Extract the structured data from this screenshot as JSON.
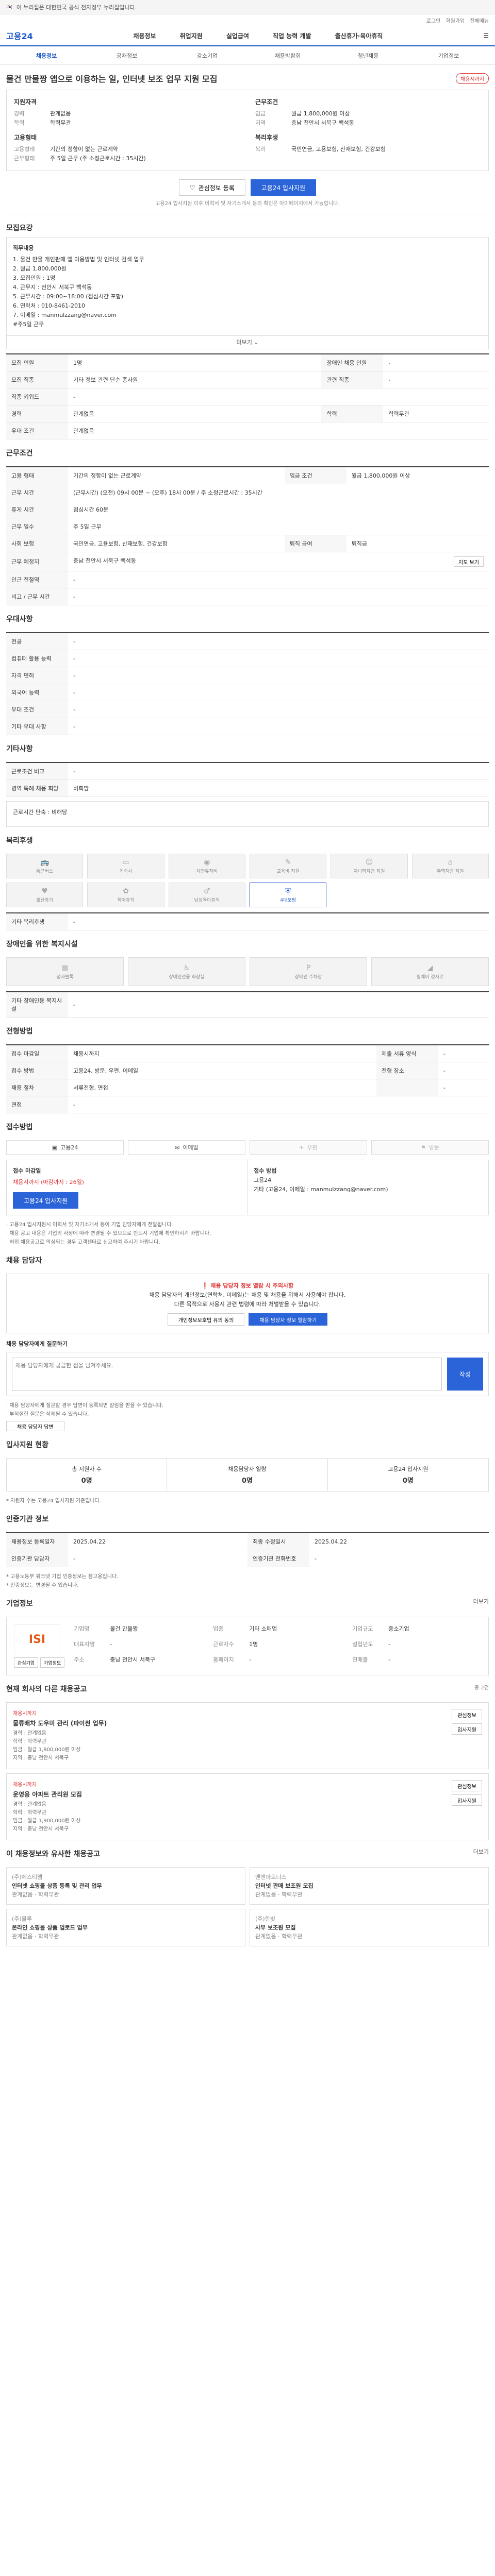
{
  "header": {
    "top_strip": "이 누리집은 대한민국 공식 전자정부 누리집입니다.",
    "logo": "고용24",
    "util": [
      "로그인",
      "회원가입",
      "전체메뉴"
    ],
    "gnb_logo": "고용24",
    "gnb_items": [
      "채용정보",
      "취업지원",
      "실업급여",
      "직업 능력 개발",
      "출산휴가·육아휴직"
    ],
    "tabs": [
      "채용정보",
      "공채정보",
      "강소기업",
      "채용박람회",
      "청년채용",
      "기업정보"
    ]
  },
  "job": {
    "title": "물건 만물짱 앱으로 이용하는 일, 인터넷 보조 업무 지원 모집",
    "badge": "채용시까지",
    "left_h": "지원자격",
    "left": [
      [
        "경력",
        "관계없음"
      ],
      [
        "학력",
        "학력무관"
      ]
    ],
    "left_h2": "고용형태",
    "left2": [
      [
        "고용형태",
        "기간의 정함이 없는 근로계약"
      ],
      [
        "근무형태",
        "주 5일 근무 (주 소정근로시간 : 35시간)"
      ]
    ],
    "right_h": "근무조건",
    "right": [
      [
        "임금",
        "월급 1,800,000원 이상"
      ],
      [
        "지역",
        "충남 천안시 서북구 백석동"
      ]
    ],
    "right_h2": "복리후생",
    "right2": [
      [
        "복리",
        "국민연금, 고용보험, 산재보험, 건강보험"
      ]
    ],
    "btn_scrap": "관심정보 등록",
    "btn_apply": "고용24 입사지원",
    "note": "고용24 입사지원 이후 이력서 및 자기소개서 등의 확인은 마이페이지에서 가능합니다."
  },
  "recruit": {
    "title": "모집요강",
    "box_h": "직무내용",
    "lines": [
      "1. 물건 만물 개인판매 앱 이용방법 및 인터넷 검색 업무",
      "2. 월급 1,800,000원",
      "3. 모집인원 : 1명",
      "4. 근무지 : 천안시 서북구 백석동",
      "5. 근무시간 : 09:00~18:00 (점심시간 포함)",
      "6. 연락처 : 010-8461-2010",
      "7. 이메일 : manmulzzang@naver.com",
      "#주5일 근무"
    ],
    "more": "더보기",
    "rows": [
      [
        "모집 인원",
        "1명",
        "장애인 채용 인원",
        "-"
      ],
      [
        "모집 직종",
        "기타 정보 관련 단순 종사원",
        "관련 직종",
        "-"
      ],
      [
        "직종 키워드",
        "-",
        "",
        ""
      ],
      [
        "경력",
        "관계없음",
        "학력",
        "학력무관"
      ],
      [
        "우대 조건",
        "관계없음",
        "",
        ""
      ]
    ]
  },
  "work": {
    "title": "근무조건",
    "rows": [
      [
        "고용 형태",
        "기간의 정함이 없는 근로계약",
        "임금 조건",
        "월급 1,800,000원 이상"
      ],
      [
        "근무 시간",
        "(근무시간) (오전) 09시 00분 ~ (오후) 18시 00분 / 주 소정근로시간 : 35시간",
        "",
        ""
      ],
      [
        "휴게 시간",
        "점심시간 60분",
        "",
        ""
      ],
      [
        "근무 일수",
        "주 5일 근무",
        "",
        ""
      ],
      [
        "사회 보험",
        "국민연금, 고용보험, 산재보험, 건강보험",
        "퇴직 급여",
        "퇴직금"
      ],
      [
        "근무 예정지",
        "충남 천안시 서북구 백석동",
        "",
        ""
      ],
      [
        "인근 전철역",
        "-",
        "",
        ""
      ],
      [
        "비고 / 근무 시간",
        "-",
        "",
        ""
      ]
    ],
    "map_btn": "지도 보기"
  },
  "prefer": {
    "title": "우대사항",
    "rows": [
      [
        "전공",
        "-"
      ],
      [
        "컴퓨터 활용 능력",
        "-"
      ],
      [
        "자격 면허",
        "-"
      ],
      [
        "외국어 능력",
        "-"
      ],
      [
        "우대 조건",
        "-"
      ],
      [
        "기타 우대 사항",
        "-"
      ]
    ]
  },
  "etc": {
    "title": "기타사항",
    "rows": [
      [
        "근로조건 비교",
        "-"
      ],
      [
        "병역 특례 채용 희망",
        "비희망"
      ]
    ],
    "box": "근로시간 단축 : 비해당"
  },
  "welfare": {
    "title": "복리후생",
    "items": [
      [
        "통근버스",
        "bus"
      ],
      [
        "기숙사",
        "bed"
      ],
      [
        "차량유지비",
        "car"
      ],
      [
        "교육비 지원",
        "edu"
      ],
      [
        "자녀학자금 지원",
        "child"
      ],
      [
        "주택자금 지원",
        "house"
      ],
      [
        "출산휴가",
        "baby"
      ],
      [
        "육아휴직",
        "care"
      ],
      [
        "남성육아휴직",
        "male"
      ],
      [
        "4대보험",
        "shield"
      ]
    ],
    "etc_label": "기타 복리후생",
    "etc_value": "-"
  },
  "disabled": {
    "title": "장애인을 위한 복지시설",
    "items": [
      "점자블록",
      "장애인전용 화장실",
      "장애인 주차장",
      "휠체어 경사로"
    ],
    "etc_label": "기타 장애인용 복지시설",
    "etc_value": "-"
  },
  "selection": {
    "title": "전형방법",
    "rows": [
      [
        "접수 마감일",
        "채용시까지",
        "제출 서류 양식",
        "-"
      ],
      [
        "접수 방법",
        "고용24, 방문, 우편, 이메일",
        "전형 장소",
        "-"
      ],
      [
        "채용 절차",
        "서류전형, 면접",
        "",
        "-"
      ],
      [
        "면접",
        "-",
        "",
        ""
      ]
    ]
  },
  "apply": {
    "title": "접수방법",
    "methods": [
      "고용24",
      "이메일",
      "우편",
      "방문"
    ],
    "left_h": "접수 마감일",
    "deadline": "채용시까지 (마감까지 : 26일)",
    "right_h": "접수 방법",
    "right_lines": [
      "고용24",
      "기타 (고용24, 이메일 : manmulzzang@naver.com)"
    ],
    "btn": "고용24 입사지원",
    "notices": [
      "· 고용24 입사지원시 이력서 및 자기소개서 등이 기업 담당자에게 전달됩니다.",
      "· 채용 공고 내용은 기업의 사정에 따라 변경될 수 있으므로 반드시 기업에 확인하시기 바랍니다.",
      "· 허위 채용공고로 의심되는 경우 고객센터로 신고하여 주시기 바랍니다."
    ]
  },
  "contact": {
    "title": "채용 담당자",
    "alert_title": "채용 담당자 정보 열람 시 주의사항",
    "alert_lines": [
      "채용 담당자의 개인정보(연락처, 이메일)는 채용 및 채용을 위해서 사용해야 합니다.",
      "다른 목적으로 사용시 관련 법령에 따라 처벌받을 수 있습니다."
    ],
    "btn_confirm": "개인정보보호법 유의 동의",
    "btn_show": "채용 담당자 정보 열람하기",
    "qa_h": "채용 담당자에게 질문하기",
    "qa_placeholder": "채용 담당자에게 궁금한 점을 남겨주세요.",
    "qa_btn": "작성",
    "qa_notes": [
      "· 채용 담당자에게 질문할 경우 답변이 등록되면 알림을 받을 수 있습니다.",
      "· 부적절한 질문은 삭제될 수 있습니다."
    ],
    "qa_extra": "채용 담당자 답변"
  },
  "stats": {
    "title": "입사지원 현황",
    "items": [
      [
        "총 지원자 수",
        "0명"
      ],
      [
        "채용담당자 열람",
        "0명"
      ],
      [
        "고용24 입사지원",
        "0명"
      ]
    ],
    "note": "* 지원자 수는 고용24 입사지원 기준입니다."
  },
  "info": {
    "title": "인증기관 정보",
    "rows": [
      [
        "채용정보 등록일자",
        "2025.04.22",
        "최종 수정일시",
        "2025.04.22"
      ],
      [
        "인증기관 담당자",
        "-",
        "인증기관 전화번호",
        "-"
      ]
    ],
    "notes": [
      "* 고용노동부 워크넷 기업 인증정보는 참고용입니다.",
      "* 인증정보는 변경될 수 있습니다."
    ]
  },
  "company": {
    "title": "기업정보",
    "more": "더보기",
    "logo_text": "ISI",
    "rows": [
      [
        "기업명",
        "물건 만물짱"
      ],
      [
        "업종",
        "기타 소매업"
      ],
      [
        "기업규모",
        "중소기업"
      ],
      [
        "대표자명",
        "-"
      ],
      [
        "근로자수",
        "1명"
      ],
      [
        "설립년도",
        "-"
      ],
      [
        "주소",
        "충남 천안시 서북구"
      ],
      [
        "홈페이지",
        "-"
      ],
      [
        "연매출",
        "-"
      ]
    ],
    "btn1": "관심기업",
    "btn2": "기업정보"
  },
  "others": {
    "title": "현재 회사의 다른 채용공고",
    "note": "총 2건",
    "jobs": [
      {
        "tag": "채용시까지",
        "title": "물류배차 도우미 관리 (파이썬 업무)",
        "meta": [
          "경력 : 관계없음",
          "학력 : 학력무관",
          "임금 : 월급 1,800,000원 이상",
          "지역 : 충남 천안시 서북구"
        ],
        "b1": "관심정보",
        "b2": "입사지원"
      },
      {
        "tag": "채용시까지",
        "title": "운영용 아파트 관리원 모집",
        "meta": [
          "경력 : 관계없음",
          "학력 : 학력무관",
          "임금 : 월급 1,900,000원 이상",
          "지역 : 충남 천안시 서북구"
        ],
        "b1": "관심정보",
        "b2": "입사지원"
      }
    ]
  },
  "similar": {
    "title": "이 채용정보와 유사한 채용공고",
    "more": "더보기",
    "items": [
      {
        "company": "(주)에스티엠",
        "title": "인터넷 쇼핑몰 상품 등록 및 관리 업무",
        "meta": "관계없음 · 학력무관"
      },
      {
        "company": "엔엔파트너스",
        "title": "인터넷 판매 보조원 모집",
        "meta": "관계없음 · 학력무관"
      },
      {
        "company": "(주)블루",
        "title": "온라인 쇼핑몰 상품 업로드 업무",
        "meta": "관계없음 · 학력무관"
      },
      {
        "company": "(주)한빛",
        "title": "사무 보조원 모집",
        "meta": "관계없음 · 학력무관"
      }
    ]
  }
}
